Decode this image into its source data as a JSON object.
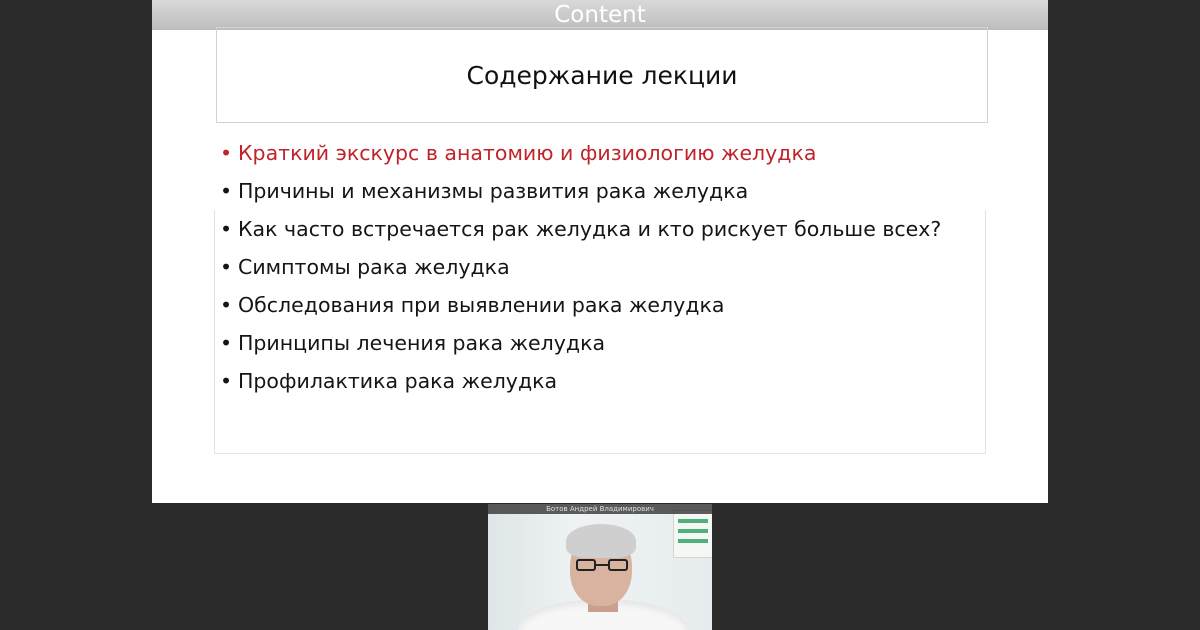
{
  "share": {
    "title": "Content"
  },
  "slide": {
    "heading": "Содержание лекции",
    "items": [
      {
        "text": "Краткий экскурс в анатомию и физиологию желудка",
        "active": true
      },
      {
        "text": "Причины и механизмы развития рака желудка",
        "active": false
      },
      {
        "text": "Как часто встречается рак желудка и кто рискует больше всех?",
        "active": false
      },
      {
        "text": "Симптомы рака желудка",
        "active": false
      },
      {
        "text": "Обследования при выявлении рака желудка",
        "active": false
      },
      {
        "text": "Принципы лечения рака желудка",
        "active": false
      },
      {
        "text": "Профилактика рака желудка",
        "active": false
      }
    ],
    "bullet": "•",
    "active_color": "#c0242b"
  },
  "participant": {
    "name": "Ботов Андрей Владимирович"
  },
  "colors": {
    "background": "#2b2b2b",
    "title_bar": "#bdbdbd"
  }
}
